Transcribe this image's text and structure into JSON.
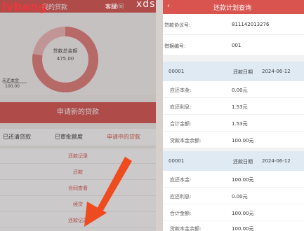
{
  "watermark": {
    "logo": "lvbang",
    "left_sub": "客服",
    "right_text": "xds"
  },
  "left": {
    "header_title": "我的贷款",
    "header_right": "合同",
    "donut_center_label": "贷款总金额",
    "donut_center_value": "475.00",
    "donut_side_label": "未还本金",
    "donut_side_value": "100.00",
    "apply_button": "申请新的贷款",
    "tabs": [
      "已还清贷款",
      "已审批额度",
      "申请中的贷款"
    ],
    "menu": [
      "还款记录",
      "还款",
      "合同查看",
      "续贷",
      "还款记录"
    ],
    "colors": {
      "brand_red": "#d9534f",
      "donut_ring": "#e27a78"
    }
  },
  "right": {
    "back_icon": "chevron-left-icon",
    "header_title": "还款计划查询",
    "agreement_label": "贷款协议号:",
    "agreement_value": "811142013276",
    "loan_no_label": "借据编号:",
    "loan_no_value": "001",
    "schedules": [
      {
        "index": "00001",
        "date_label": "还款日期",
        "date_value": "2024-06-12",
        "rows": [
          {
            "label": "应还本金:",
            "value": "0.00元"
          },
          {
            "label": "应还利息:",
            "value": "1.53元"
          },
          {
            "label": "合计金额:",
            "value": "1.53元"
          },
          {
            "label": "贷款本金余额:",
            "value": "100.00元"
          }
        ]
      },
      {
        "index": "00001",
        "date_label": "还款日期",
        "date_value": "2024-06-12",
        "rows": [
          {
            "label": "应还本金:",
            "value": "100.00元"
          },
          {
            "label": "应还利息:",
            "value": "0.00元"
          },
          {
            "label": "合计金额:",
            "value": "100.00元"
          },
          {
            "label": "贷款本金余额:",
            "value": "100.00元"
          }
        ]
      }
    ],
    "colors": {
      "header_red": "#d9534f",
      "schedule_head_bg": "#dfeaf3"
    }
  }
}
